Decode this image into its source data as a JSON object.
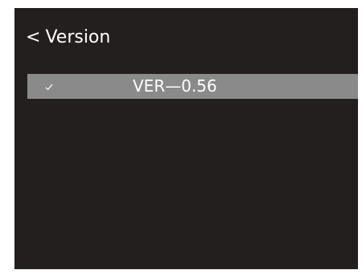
{
  "header": {
    "back_symbol": "<",
    "title": "Version"
  },
  "version_list": {
    "items": [
      {
        "label": "VER—0.56",
        "selected": true,
        "icon": "check-icon"
      }
    ]
  },
  "colors": {
    "screen_background": "#231f1e",
    "selected_row": "#8a8a8a",
    "text": "#ffffff"
  }
}
